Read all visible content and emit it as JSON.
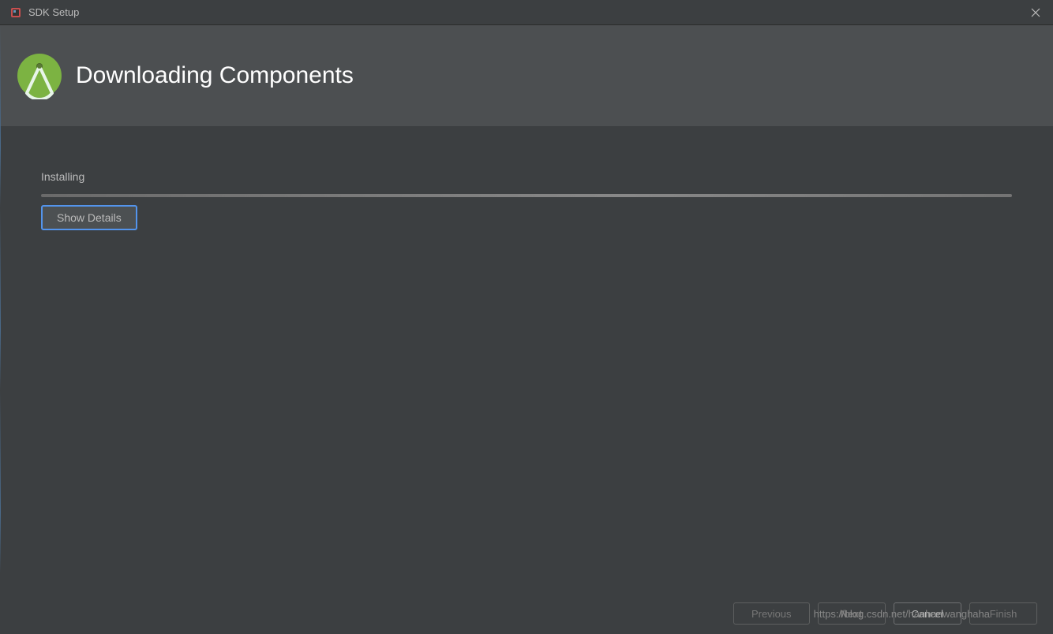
{
  "titlebar": {
    "title": "SDK Setup"
  },
  "header": {
    "title": "Downloading Components"
  },
  "content": {
    "status": "Installing",
    "show_details_label": "Show Details"
  },
  "footer": {
    "previous_label": "Previous",
    "next_label": "Next",
    "cancel_label": "Cancel",
    "finish_label": "Finish"
  },
  "watermark": "https://blog.csdn.net/hanhanwanghaha"
}
